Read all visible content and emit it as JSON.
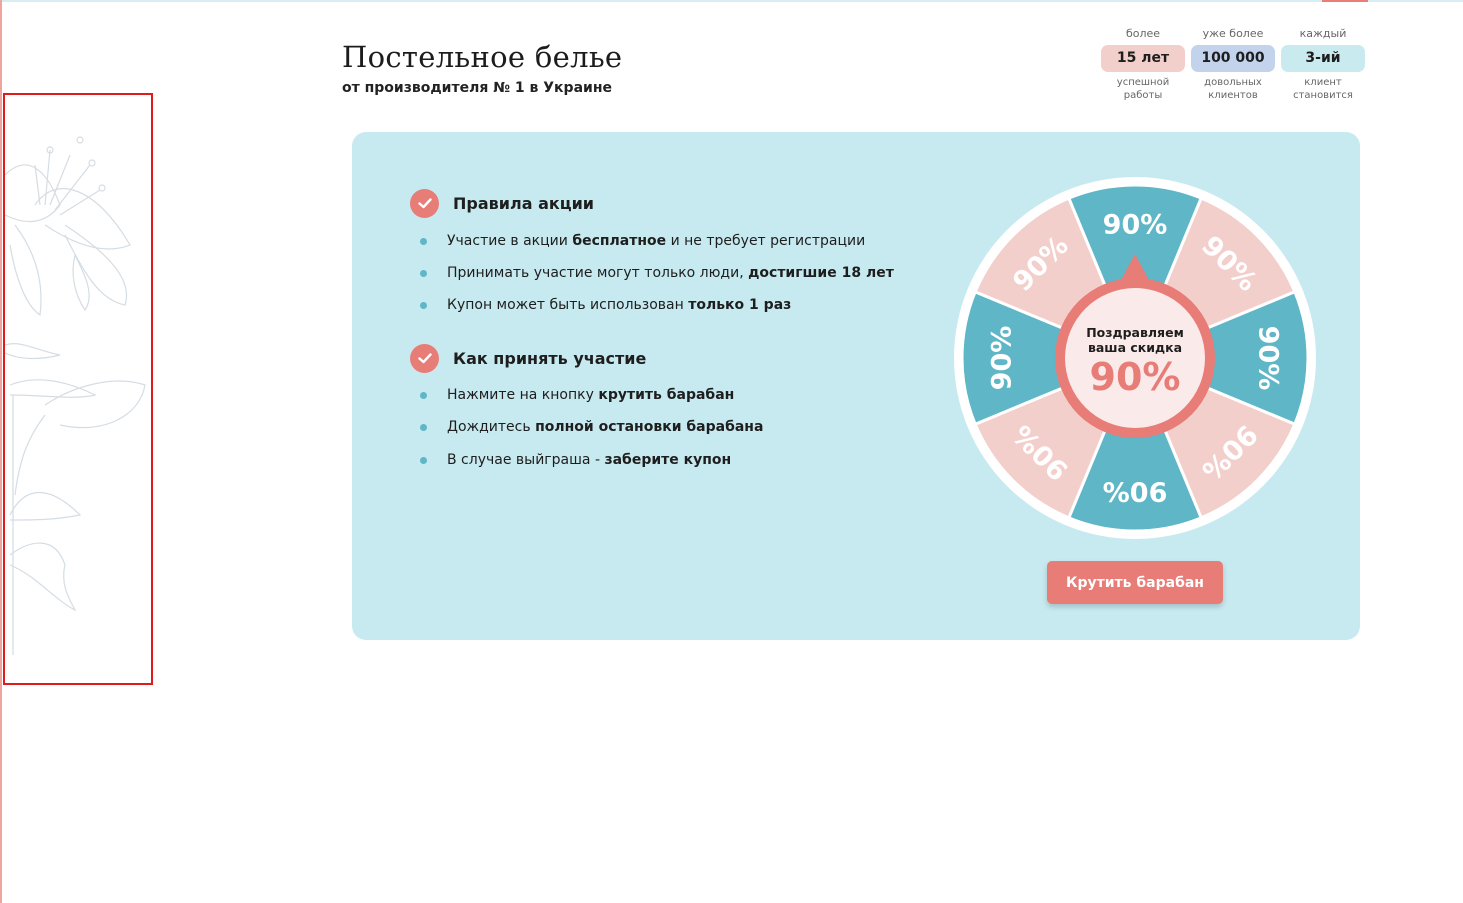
{
  "header": {
    "title": "Постельное белье",
    "subtitle": "от производителя № 1 в Украине"
  },
  "stats": [
    {
      "pre": "более",
      "value": "15 лет",
      "post_line1": "успешной",
      "post_line2": "работы",
      "color": "#f3cfcc"
    },
    {
      "pre": "уже более",
      "value": "100 000",
      "post_line1": "довольных",
      "post_line2": "клиентов",
      "color": "#c3d3ec"
    },
    {
      "pre": "каждый",
      "value": "3-ий",
      "post_line1": "клиент",
      "post_line2": "становится",
      "color": "#c9ebf0"
    }
  ],
  "rules_section": {
    "title": "Правила акции",
    "items": [
      {
        "text": "Участие в акции ",
        "bold": "бесплатное",
        "tail": " и не требует регистрации"
      },
      {
        "text": "Принимать участие могут только люди, ",
        "bold": "достигшие 18 лет",
        "tail": ""
      },
      {
        "text": "Купон может быть использован ",
        "bold": "только 1 раз",
        "tail": ""
      }
    ]
  },
  "how_section": {
    "title": "Как принять участие",
    "items": [
      {
        "text": "Нажмите на кнопку ",
        "bold": "крутить барабан",
        "tail": ""
      },
      {
        "text": "Дождитесь ",
        "bold": "полной остановки барабана",
        "tail": ""
      },
      {
        "text": "В случае выйграша - ",
        "bold": "заберите купон",
        "tail": ""
      }
    ]
  },
  "wheel": {
    "segment_label": "90%",
    "segment_count": 8,
    "colors": {
      "teal": "#5eb6c6",
      "pink": "#f3cfcc",
      "rim": "#ffffff",
      "hub": "#e87c77",
      "hub_inner": "#fbeaea"
    },
    "center_line1": "Поздравляем",
    "center_line2": "ваша скидка",
    "center_value": "90%"
  },
  "spin_button": {
    "label": "Крутить барабан"
  },
  "colors": {
    "accent": "#e87c77",
    "panel": "#c7eaf0",
    "bullet": "#5eb6c6"
  }
}
